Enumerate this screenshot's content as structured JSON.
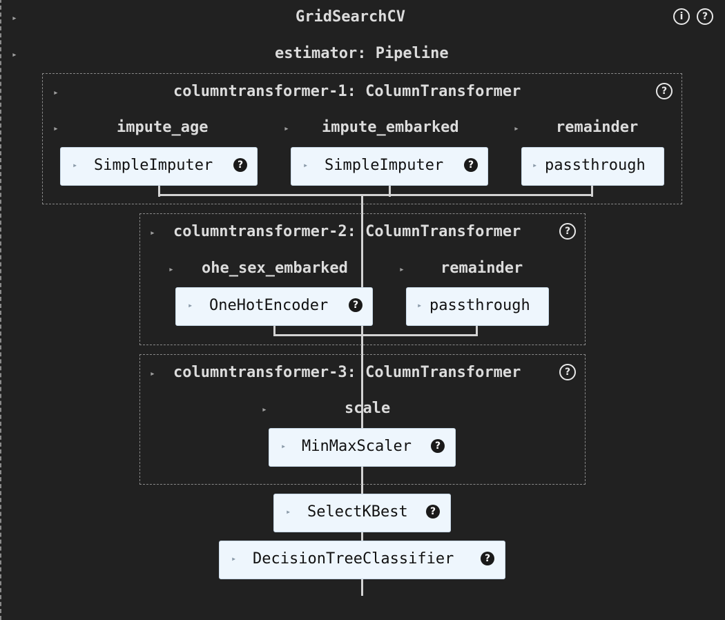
{
  "root": {
    "title": "GridSearchCV",
    "info_icon": "info-icon",
    "help_icon": "help-icon"
  },
  "estimator": {
    "label": "estimator: Pipeline"
  },
  "ct1": {
    "title": "columntransformer-1: ColumnTransformer",
    "branches": [
      {
        "name": "impute_age",
        "step": "SimpleImputer"
      },
      {
        "name": "impute_embarked",
        "step": "SimpleImputer"
      },
      {
        "name": "remainder",
        "step": "passthrough"
      }
    ]
  },
  "ct2": {
    "title": "columntransformer-2: ColumnTransformer",
    "branches": [
      {
        "name": "ohe_sex_embarked",
        "step": "OneHotEncoder"
      },
      {
        "name": "remainder",
        "step": "passthrough"
      }
    ]
  },
  "ct3": {
    "title": "columntransformer-3: ColumnTransformer",
    "branches": [
      {
        "name": "scale",
        "step": "MinMaxScaler"
      }
    ]
  },
  "steps": {
    "select": "SelectKBest",
    "classifier": "DecisionTreeClassifier"
  },
  "glyphs": {
    "toggle": "▸",
    "question": "?",
    "info": "i"
  }
}
